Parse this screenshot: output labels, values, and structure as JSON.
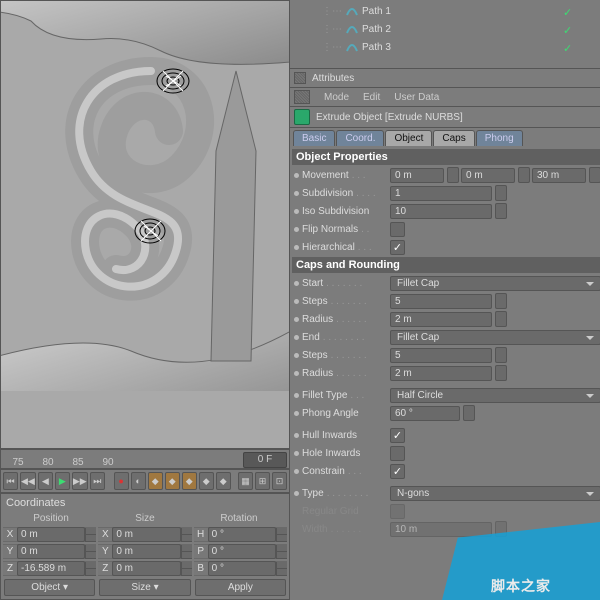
{
  "hierarchy": {
    "items": [
      {
        "label": "Path 1"
      },
      {
        "label": "Path 2"
      },
      {
        "label": "Path 3"
      }
    ]
  },
  "attributes": {
    "title": "Attributes",
    "menu": {
      "mode": "Mode",
      "edit": "Edit",
      "userdata": "User Data"
    },
    "object_title": "Extrude Object [Extrude NURBS]",
    "tabs": {
      "basic": "Basic",
      "coord": "Coord.",
      "object": "Object",
      "caps": "Caps",
      "phong": "Phong"
    }
  },
  "object_props": {
    "section": "Object Properties",
    "movement_label": "Movement",
    "movement_x": "0 m",
    "movement_y": "0 m",
    "movement_z": "30 m",
    "subdivision_label": "Subdivision",
    "subdivision": "1",
    "iso_label": "Iso Subdivision",
    "iso": "10",
    "flip_label": "Flip Normals",
    "flip": false,
    "hier_label": "Hierarchical",
    "hier": true
  },
  "caps": {
    "section": "Caps and Rounding",
    "start_label": "Start",
    "start": "Fillet Cap",
    "steps_label": "Steps",
    "steps1": "5",
    "radius_label": "Radius",
    "radius1": "2 m",
    "end_label": "End",
    "end": "Fillet Cap",
    "steps2": "5",
    "radius2": "2 m",
    "fillet_type_label": "Fillet Type",
    "fillet_type": "Half Circle",
    "phong_label": "Phong Angle",
    "phong": "60 °",
    "hull_label": "Hull Inwards",
    "hull": true,
    "hole_label": "Hole Inwards",
    "hole": false,
    "constrain_label": "Constrain",
    "constrain": true,
    "type_label": "Type",
    "type": "N-gons",
    "reg_label": "Regular Grid",
    "reg": false,
    "width_label": "Width",
    "width": "10 m"
  },
  "timeline": {
    "f75": "75",
    "f80": "80",
    "f85": "85",
    "f90": "90",
    "unit": "0 F"
  },
  "coords": {
    "title": "Coordinates",
    "hdr_pos": "Position",
    "hdr_size": "Size",
    "hdr_rot": "Rotation",
    "x": "0 m",
    "y": "0 m",
    "z": "-16.589 m",
    "sx": "0 m",
    "sy": "0 m",
    "sz": "0 m",
    "h": "0 °",
    "p": "0 °",
    "b": "0 °",
    "mode": "Object",
    "size_mode": "Size",
    "apply": "Apply"
  },
  "watermark": "脚本之家"
}
